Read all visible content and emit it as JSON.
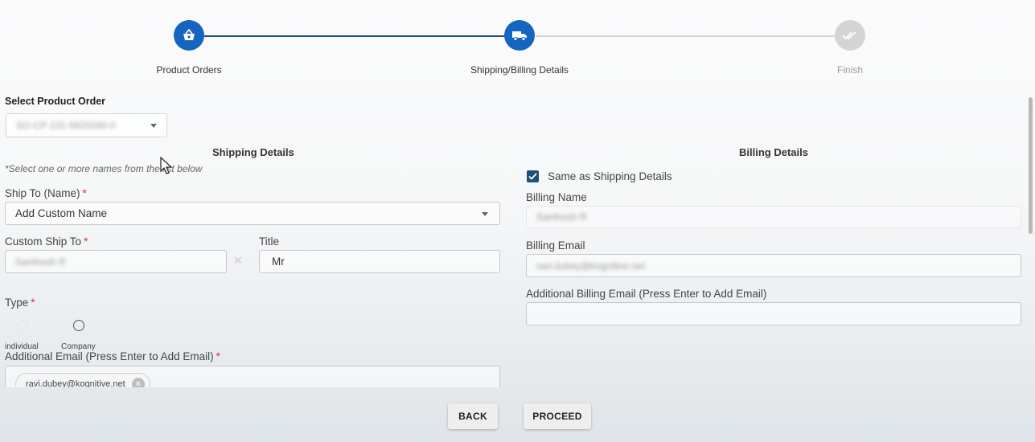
{
  "stepper": {
    "steps": [
      {
        "label": "Product Orders",
        "icon": "basket-icon",
        "state": "complete"
      },
      {
        "label": "Shipping/Billing Details",
        "icon": "truck-icon",
        "state": "active"
      },
      {
        "label": "Finish",
        "icon": "double-check-icon",
        "state": "pending"
      }
    ],
    "colors": {
      "active": "#1565c0",
      "line_active": "#1e4f7a",
      "pending": "#d4d4d4"
    }
  },
  "product_order": {
    "label": "Select Product Order",
    "value": "SO-CP-131-5620240-0"
  },
  "shipping": {
    "title": "Shipping Details",
    "hint": "*Select one or more names from the list below",
    "ship_to_label": "Ship To (Name)",
    "ship_to_value": "Add Custom Name",
    "custom_ship_to_label": "Custom Ship To",
    "custom_ship_to_value": "Santhosh R",
    "title_label": "Title",
    "title_value": "Mr",
    "type_label": "Type",
    "type_options": [
      "individual",
      "Company"
    ],
    "additional_email_label": "Additional Email (Press Enter to Add Email)",
    "email_chip": "ravi.dubey@kognitive.net",
    "required_mark": "*"
  },
  "billing": {
    "title": "Billing Details",
    "same_as_label": "Same as Shipping Details",
    "same_as_checked": true,
    "billing_name_label": "Billing Name",
    "billing_name_value": "Santhosh R",
    "billing_email_label": "Billing Email",
    "billing_email_value": "ravi.dubey@kognitive.net",
    "additional_billing_label": "Additional Billing Email (Press Enter to Add Email)",
    "additional_billing_value": ""
  },
  "actions": {
    "back_label": "BACK",
    "proceed_label": "PROCEED"
  }
}
